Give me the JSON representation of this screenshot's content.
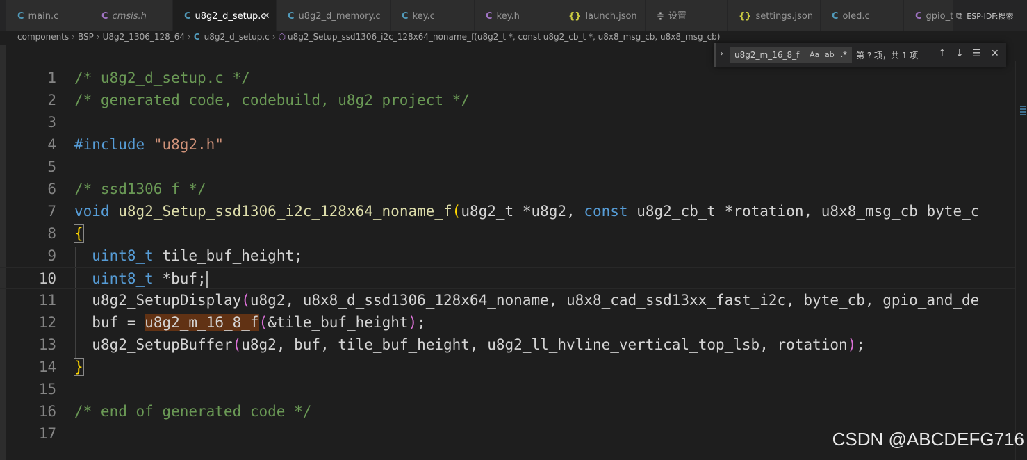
{
  "tabs": [
    {
      "icon": "C",
      "label": "main.c",
      "icon_color": "#519aba",
      "italic": false,
      "active": false
    },
    {
      "icon": "C",
      "label": "cmsis.h",
      "icon_color": "#a074c4",
      "italic": true,
      "active": false
    },
    {
      "icon": "C",
      "label": "u8g2_d_setup.c",
      "icon_color": "#519aba",
      "italic": false,
      "active": true
    },
    {
      "icon": "C",
      "label": "u8g2_d_memory.c",
      "icon_color": "#519aba",
      "italic": false,
      "active": false
    },
    {
      "icon": "C",
      "label": "key.c",
      "icon_color": "#519aba",
      "italic": false,
      "active": false
    },
    {
      "icon": "C",
      "label": "key.h",
      "icon_color": "#a074c4",
      "italic": false,
      "active": false
    },
    {
      "icon": "{}",
      "label": "launch.json",
      "icon_color": "#cbcb41",
      "italic": false,
      "active": false
    },
    {
      "icon": "≑",
      "label": "设置",
      "icon_color": "#cccccc",
      "italic": false,
      "active": false
    },
    {
      "icon": "{}",
      "label": "settings.json",
      "icon_color": "#cbcb41",
      "italic": false,
      "active": false
    },
    {
      "icon": "C",
      "label": "oled.c",
      "icon_color": "#519aba",
      "italic": false,
      "active": false
    },
    {
      "icon": "C",
      "label": "gpio_t",
      "icon_color": "#a074c4",
      "italic": false,
      "active": false
    }
  ],
  "tab_close": "✕",
  "actions": {
    "split_icon": "⧉",
    "esp_label": "ESP-IDF:",
    "search_label": "搜索"
  },
  "breadcrumb": {
    "parts": [
      "components",
      "BSP",
      "U8g2_1306_128_64"
    ],
    "file": "u8g2_d_setup.c",
    "symbol": "u8g2_Setup_ssd1306_i2c_128x64_noname_f(u8g2_t *, const u8g2_cb_t *, u8x8_msg_cb, u8x8_msg_cb)"
  },
  "find": {
    "query": "u8g2_m_16_8_f",
    "opt_case": "Aa",
    "opt_word": "ab",
    "opt_regex": ".*",
    "result": "第 ? 项，共 1 项"
  },
  "code": {
    "current_line": 10,
    "line_numbers": [
      "1",
      "2",
      "3",
      "4",
      "5",
      "6",
      "7",
      "8",
      "9",
      "10",
      "11",
      "12",
      "13",
      "14",
      "15",
      "16",
      "17"
    ],
    "l1": "/* u8g2_d_setup.c */",
    "l2": "/* generated code, codebuild, u8g2 project */",
    "l4_directive": "#include",
    "l4_file": "\"u8g2.h\"",
    "l6": "/* ssd1306 f */",
    "l7_void": "void",
    "l7_fn": "u8g2_Setup_ssd1306_i2c_128x64_noname_f",
    "l7_t1": "u8g2_t",
    "l7_p1": "*u8g2,",
    "l7_const": "const",
    "l7_t2": "u8g2_cb_t",
    "l7_p2": "*rotation,",
    "l7_t3": "u8x8_msg_cb",
    "l7_p3": "byte_c",
    "l8": "{",
    "l9_type": "uint8_t",
    "l9_var": "tile_buf_height;",
    "l10_type": "uint8_t",
    "l10_var": "*buf;",
    "l11_fn": "u8g2_SetupDisplay",
    "l11_args": "u8g2, u8x8_d_ssd1306_128x64_noname, u8x8_cad_ssd13xx_fast_i2c, byte_cb, gpio_and_de",
    "l12_var": "buf",
    "l12_eq": " = ",
    "l12_fn": "u8g2_m_16_8_f",
    "l12_args": "&tile_buf_height",
    "l12_end": ";",
    "l13_fn": "u8g2_SetupBuffer",
    "l13_args": "u8g2, buf, tile_buf_height, u8g2_ll_hvline_vertical_top_lsb, rotation",
    "l13_end": ";",
    "l14": "}",
    "l16": "/* end of generated code */"
  },
  "watermark": "CSDN @ABCDEFG716"
}
